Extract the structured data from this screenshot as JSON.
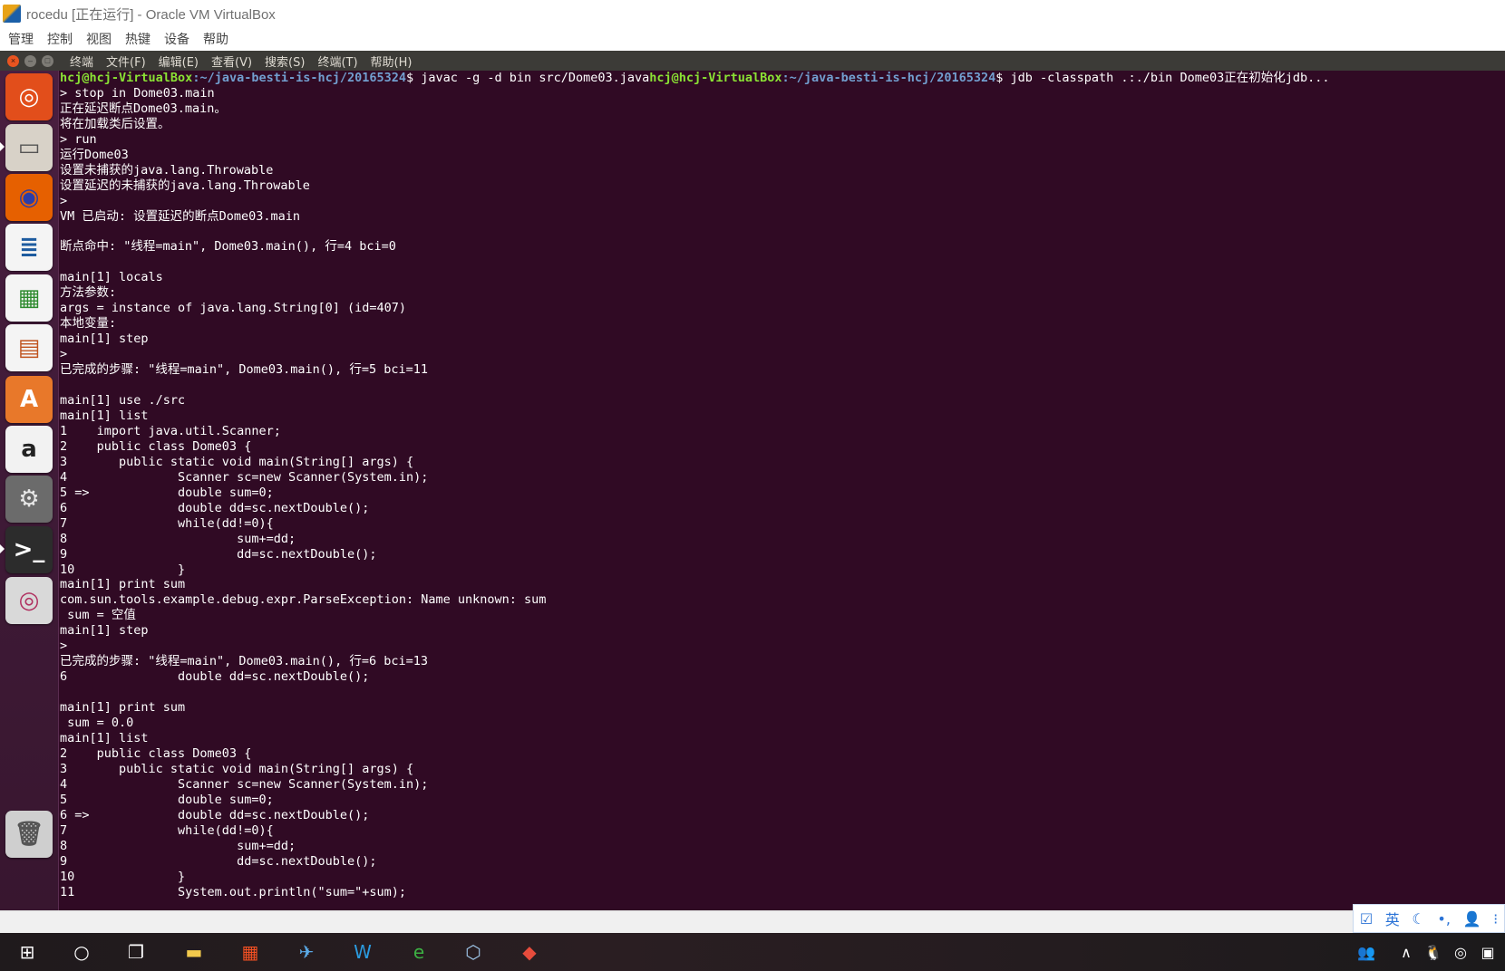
{
  "vbox": {
    "title": "rocedu [正在运行] - Oracle VM VirtualBox",
    "menu": [
      "管理",
      "控制",
      "视图",
      "热键",
      "设备",
      "帮助"
    ]
  },
  "guest": {
    "menu": [
      "终端",
      "文件(F)",
      "编辑(E)",
      "查看(V)",
      "搜索(S)",
      "终端(T)",
      "帮助(H)"
    ],
    "window_buttons": {
      "close": "×",
      "minimize": "–",
      "maximize": "□"
    }
  },
  "launcher": {
    "items": [
      {
        "name": "ubuntu-dash-icon",
        "glyph": "◎",
        "bg": "#e24e1b",
        "fg": "#ffffff"
      },
      {
        "name": "files-icon",
        "glyph": "▭",
        "bg": "#d8d2c8",
        "fg": "#555555"
      },
      {
        "name": "firefox-icon",
        "glyph": "◉",
        "bg": "#e66000",
        "fg": "#2b3da8"
      },
      {
        "name": "writer-icon",
        "glyph": "≣",
        "bg": "#f4f4f4",
        "fg": "#1d5b9f"
      },
      {
        "name": "calc-icon",
        "glyph": "▦",
        "bg": "#f4f4f4",
        "fg": "#2e8b2e"
      },
      {
        "name": "impress-icon",
        "glyph": "▤",
        "bg": "#f4f4f4",
        "fg": "#c0541f"
      },
      {
        "name": "software-center-icon",
        "glyph": "A",
        "bg": "#e8782a",
        "fg": "#ffffff"
      },
      {
        "name": "amazon-icon",
        "glyph": "a",
        "bg": "#f2f2f2",
        "fg": "#222222"
      },
      {
        "name": "system-settings-icon",
        "glyph": "⚙",
        "bg": "#6b6b6b",
        "fg": "#e8e8e8"
      },
      {
        "name": "terminal-icon",
        "glyph": ">_",
        "bg": "#2c2c2c",
        "fg": "#ffffff"
      },
      {
        "name": "dvd-icon",
        "glyph": "◎",
        "bg": "#d9d9d9",
        "fg": "#b03060"
      },
      {
        "name": "trash-icon",
        "glyph": "🗑",
        "bg": "#cfcfcf",
        "fg": "#555555"
      }
    ]
  },
  "terminal": {
    "prompt_user": "hcj@hcj-VirtualBox",
    "prompt_path": ":~/java-besti-is-hcj/20165324",
    "cmd1": "$ javac -g -d bin src/Dome03.java",
    "cmd2": "$ jdb -classpath .:./bin Dome03正在初始化jdb...",
    "lines": [
      "> stop in Dome03.main",
      "正在延迟断点Dome03.main。",
      "将在加载类后设置。",
      "> run",
      "运行Dome03",
      "设置未捕获的java.lang.Throwable",
      "设置延迟的未捕获的java.lang.Throwable",
      ">",
      "VM 已启动: 设置延迟的断点Dome03.main",
      "",
      "断点命中: \"线程=main\", Dome03.main(), 行=4 bci=0",
      "",
      "main[1] locals",
      "方法参数:",
      "args = instance of java.lang.String[0] (id=407)",
      "本地变量:",
      "main[1] step",
      ">",
      "已完成的步骤: \"线程=main\", Dome03.main(), 行=5 bci=11",
      "",
      "main[1] use ./src",
      "main[1] list",
      "1    import java.util.Scanner;",
      "2    public class Dome03 {",
      "3       public static void main(String[] args) {",
      "4               Scanner sc=new Scanner(System.in);",
      "5 =>            double sum=0;",
      "6               double dd=sc.nextDouble();",
      "7               while(dd!=0){",
      "8                       sum+=dd;",
      "9                       dd=sc.nextDouble();",
      "10              }",
      "main[1] print sum",
      "com.sun.tools.example.debug.expr.ParseException: Name unknown: sum",
      " sum = 空值",
      "main[1] step",
      ">",
      "已完成的步骤: \"线程=main\", Dome03.main(), 行=6 bci=13",
      "6               double dd=sc.nextDouble();",
      "",
      "main[1] print sum",
      " sum = 0.0",
      "main[1] list",
      "2    public class Dome03 {",
      "3       public static void main(String[] args) {",
      "4               Scanner sc=new Scanner(System.in);",
      "5               double sum=0;",
      "6 =>            double dd=sc.nextDouble();",
      "7               while(dd!=0){",
      "8                       sum+=dd;",
      "9                       dd=sc.nextDouble();",
      "10              }",
      "11              System.out.println(\"sum=\"+sum);"
    ]
  },
  "ime": {
    "items": [
      {
        "name": "ime-checkbox-icon",
        "glyph": "☑"
      },
      {
        "name": "ime-lang-label",
        "glyph": "英"
      },
      {
        "name": "ime-moon-icon",
        "glyph": "☾"
      },
      {
        "name": "ime-punct-icon",
        "glyph": "•,"
      },
      {
        "name": "ime-user-icon",
        "glyph": "👤"
      },
      {
        "name": "ime-more-icon",
        "glyph": "⁝"
      }
    ]
  },
  "taskbar": {
    "items": [
      {
        "name": "windows-start-icon",
        "glyph": "⊞",
        "color": "#ffffff"
      },
      {
        "name": "cortana-search-icon",
        "glyph": "○",
        "color": "#ffffff"
      },
      {
        "name": "task-view-icon",
        "glyph": "❐",
        "color": "#ffffff"
      },
      {
        "name": "file-explorer-icon",
        "glyph": "▬",
        "color": "#f2c94c"
      },
      {
        "name": "microsoft-store-icon",
        "glyph": "▦",
        "color": "#f25022"
      },
      {
        "name": "app-bird-icon",
        "glyph": "✈",
        "color": "#5aa9e6"
      },
      {
        "name": "app-w-icon",
        "glyph": "W",
        "color": "#2b9be0"
      },
      {
        "name": "browser-e-icon",
        "glyph": "e",
        "color": "#3cb043"
      },
      {
        "name": "virtualbox-icon",
        "glyph": "⬡",
        "color": "#9fc5e8"
      },
      {
        "name": "app-red-icon",
        "glyph": "◆",
        "color": "#e74c3c"
      }
    ],
    "tray": [
      {
        "name": "people-icon",
        "glyph": "👥"
      },
      {
        "name": "tray-expand-icon",
        "glyph": "∧"
      },
      {
        "name": "qq-icon",
        "glyph": "🐧"
      },
      {
        "name": "tray-green-icon",
        "glyph": "◎"
      },
      {
        "name": "nvidia-icon",
        "glyph": "▣"
      }
    ]
  }
}
